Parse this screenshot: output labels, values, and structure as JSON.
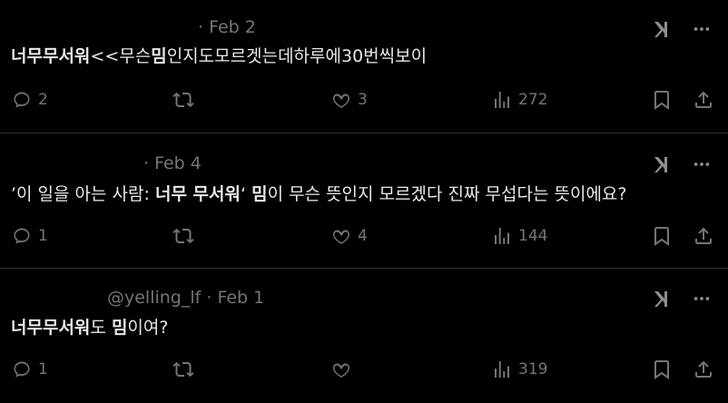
{
  "tweets": [
    {
      "meta": "· Feb 2",
      "text_parts": [
        {
          "t": "너무무서워",
          "b": true
        },
        {
          "t": "<<무슨",
          "b": false
        },
        {
          "t": "밈",
          "b": true
        },
        {
          "t": "인지도모르겟는데하루에30번씩보이",
          "b": false
        }
      ],
      "replies": "2",
      "retweets": "",
      "likes": "3",
      "views": "272"
    },
    {
      "meta": "· Feb 4",
      "text_parts": [
        {
          "t": "’이 일을 아는 사람: ",
          "b": false
        },
        {
          "t": "너무 무서워",
          "b": true
        },
        {
          "t": "‘ ",
          "b": false
        },
        {
          "t": "밈",
          "b": true
        },
        {
          "t": "이 무슨 뜻인지 모르겠다 진짜 무섭다는 뜻이에요?",
          "b": false
        }
      ],
      "replies": "1",
      "retweets": "",
      "likes": "4",
      "views": "144"
    },
    {
      "meta": "@yelling_lf · Feb 1",
      "text_parts": [
        {
          "t": "너무무서워",
          "b": true
        },
        {
          "t": "도 ",
          "b": false
        },
        {
          "t": "밈",
          "b": true
        },
        {
          "t": "이여?",
          "b": false
        }
      ],
      "replies": "1",
      "retweets": "",
      "likes": "",
      "views": "319"
    }
  ],
  "icons": {
    "reply": "reply-icon",
    "retweet": "retweet-icon",
    "like": "heart-icon",
    "views": "views-icon",
    "bookmark": "bookmark-icon",
    "share": "share-icon",
    "grok": "grok-icon",
    "more": "more-icon"
  },
  "colors": {
    "background": "#000000",
    "text": "#e7e9ea",
    "muted": "#71767b",
    "divider": "#2f3336"
  }
}
